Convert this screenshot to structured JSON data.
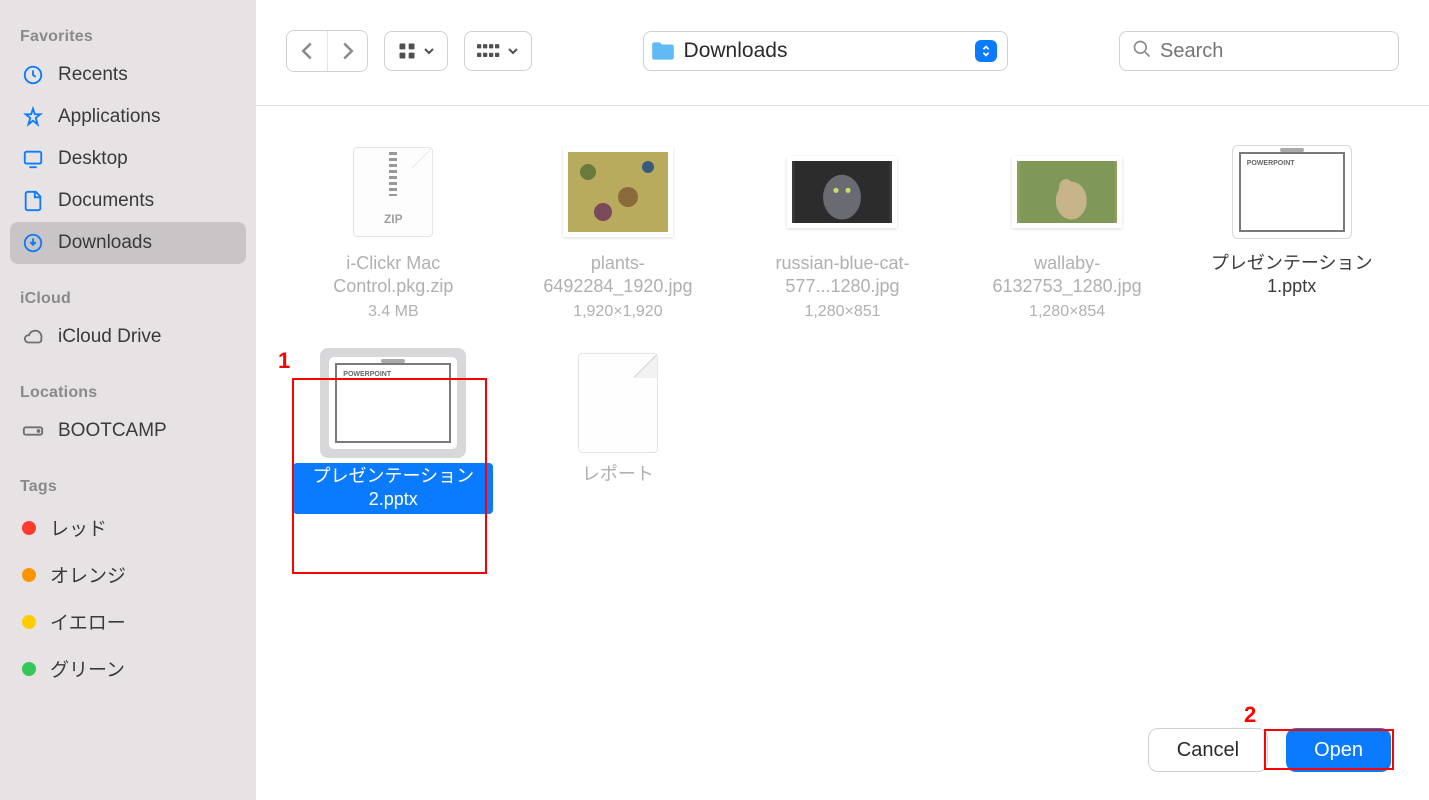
{
  "sidebar": {
    "sections": {
      "favorites_title": "Favorites",
      "icloud_title": "iCloud",
      "locations_title": "Locations",
      "tags_title": "Tags"
    },
    "favorites": [
      {
        "label": "Recents",
        "icon": "clock"
      },
      {
        "label": "Applications",
        "icon": "apps"
      },
      {
        "label": "Desktop",
        "icon": "desktop"
      },
      {
        "label": "Documents",
        "icon": "document"
      },
      {
        "label": "Downloads",
        "icon": "download",
        "active": true
      }
    ],
    "icloud": [
      {
        "label": "iCloud Drive",
        "icon": "cloud"
      }
    ],
    "locations": [
      {
        "label": "BOOTCAMP",
        "icon": "disk"
      }
    ],
    "tags": [
      {
        "label": "レッド",
        "color": "red"
      },
      {
        "label": "オレンジ",
        "color": "orange"
      },
      {
        "label": "イエロー",
        "color": "yellow"
      },
      {
        "label": "グリーン",
        "color": "green"
      }
    ]
  },
  "toolbar": {
    "location": "Downloads",
    "search_placeholder": "Search"
  },
  "files": [
    {
      "name": "i-Clickr Mac Control.pkg.zip",
      "meta": "3.4 MB",
      "type": "zip",
      "dimmed": true
    },
    {
      "name": "plants-6492284_1920.jpg",
      "meta": "1,920×1,920",
      "type": "img-plants",
      "dimmed": true
    },
    {
      "name": "russian-blue-cat-577...1280.jpg",
      "meta": "1,280×851",
      "type": "img-cat",
      "dimmed": true
    },
    {
      "name": "wallaby-6132753_1280.jpg",
      "meta": "1,280×854",
      "type": "img-wallaby",
      "dimmed": true
    },
    {
      "name": "プレゼンテーション1.pptx",
      "meta": "",
      "type": "pptx",
      "dimmed": false
    },
    {
      "name": "プレゼンテーション2.pptx",
      "meta": "",
      "type": "pptx",
      "dimmed": false,
      "selected": true
    },
    {
      "name": "レポート",
      "meta": "",
      "type": "doc",
      "dimmed": true
    }
  ],
  "buttons": {
    "cancel": "Cancel",
    "open": "Open"
  },
  "annotations": {
    "one": "1",
    "two": "2"
  },
  "pptx_thumb_label": "POWERPOINT"
}
